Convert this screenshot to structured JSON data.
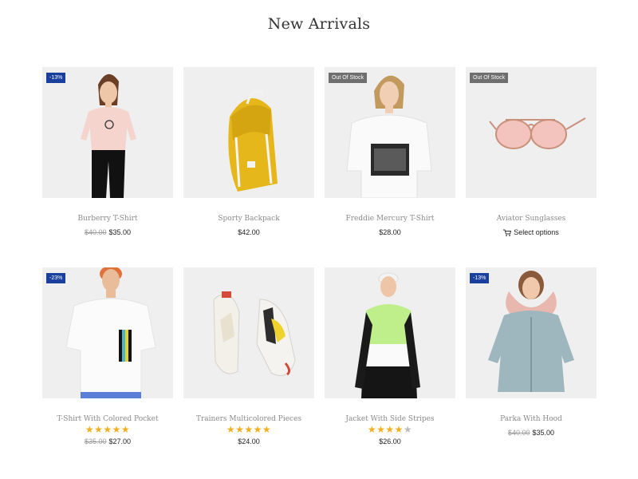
{
  "section_title": "New Arrivals",
  "colors": {
    "sale_badge": "#1a3f9c",
    "oos_badge": "#6f6f6f",
    "star": "#f2b01e"
  },
  "products": [
    {
      "name": "Burberry T-Shirt",
      "badge": "-13%",
      "old_price": "$40.00",
      "price": "$35.00",
      "image_icon": "woman-pink-tshirt-image"
    },
    {
      "name": "Sporty Backpack",
      "price": "$42.00",
      "image_icon": "yellow-backpack-image"
    },
    {
      "name": "Freddie Mercury T-Shirt",
      "badge": "Out Of Stock",
      "price": "$28.00",
      "image_icon": "woman-white-tshirt-image"
    },
    {
      "name": "Aviator Sunglasses",
      "badge": "Out Of Stock",
      "select_label": "Select options",
      "image_icon": "sunglasses-image"
    },
    {
      "name": "T-Shirt With Colored Pocket",
      "badge": "-23%",
      "rating": 5,
      "old_price": "$35.00",
      "price": "$27.00",
      "image_icon": "man-white-tshirt-image"
    },
    {
      "name": "Trainers Multicolored Pieces",
      "rating": 5,
      "price": "$24.00",
      "image_icon": "sneakers-image"
    },
    {
      "name": "Jacket With Side Stripes",
      "rating": 4.5,
      "price": "$26.00",
      "image_icon": "man-jacket-image"
    },
    {
      "name": "Parka With Hood",
      "badge": "-13%",
      "old_price": "$40.00",
      "price": "$35.00",
      "image_icon": "woman-parka-image"
    }
  ]
}
